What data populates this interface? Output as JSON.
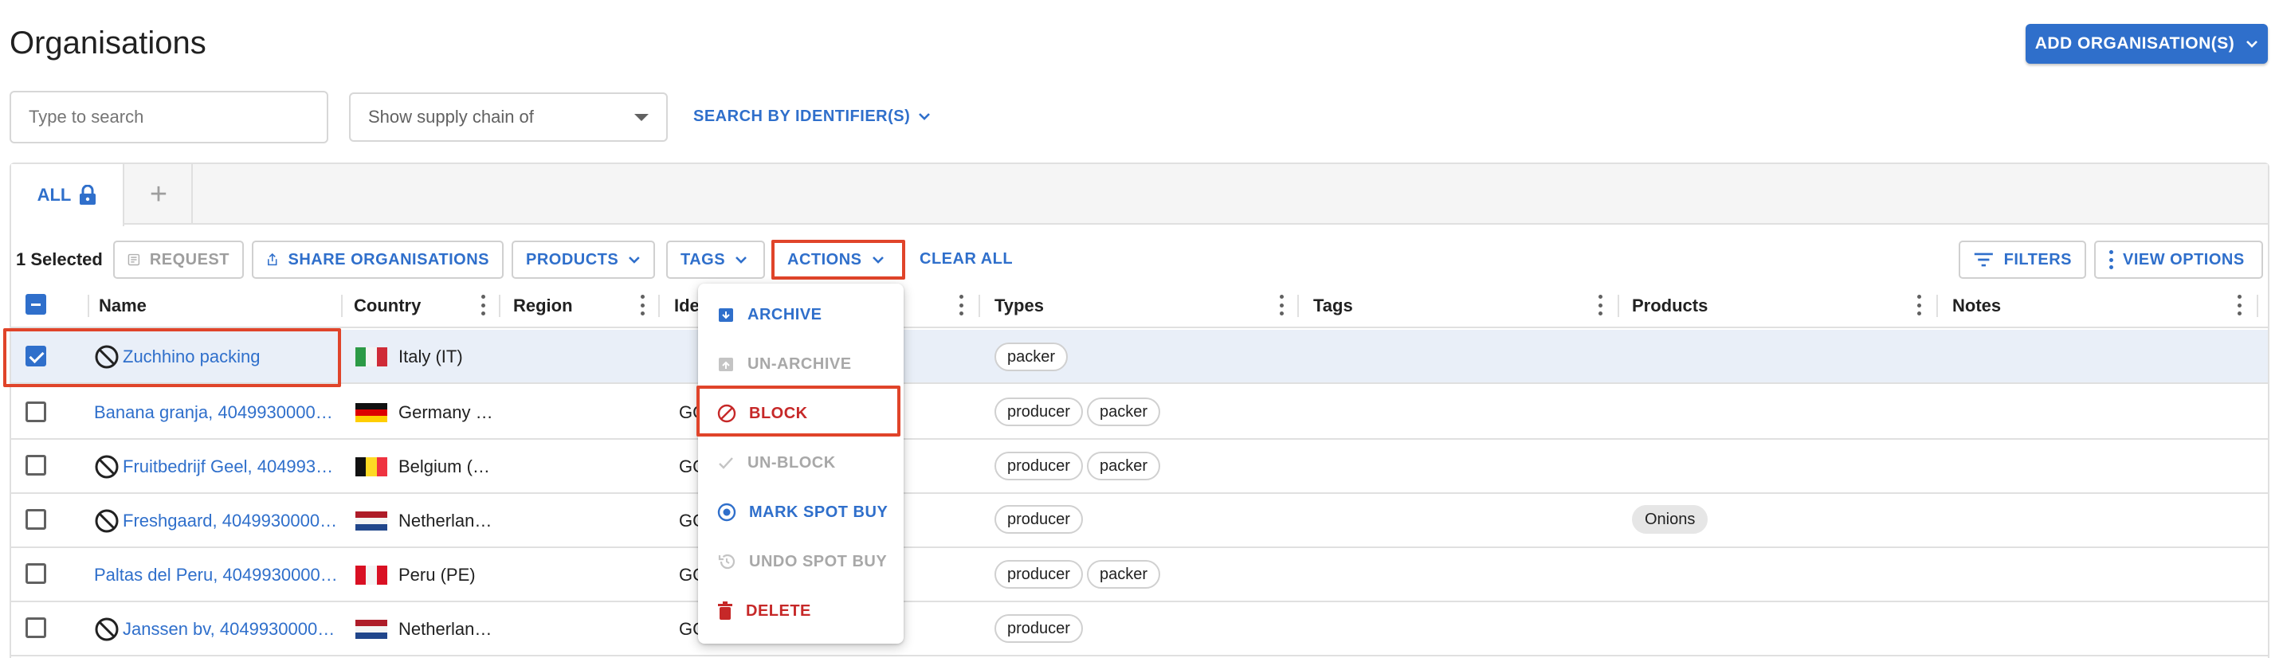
{
  "header": {
    "title": "Organisations",
    "add_button": "ADD ORGANISATION(S)"
  },
  "search": {
    "placeholder": "Type to search",
    "supply_chain_placeholder": "Show supply chain of",
    "identifier_button": "SEARCH BY IDENTIFIER(S)"
  },
  "tabs": {
    "all_label": "ALL",
    "add_label": "+"
  },
  "toolbar": {
    "selected_count": "1 Selected",
    "request": "REQUEST",
    "share": "SHARE ORGANISATIONS",
    "products": "PRODUCTS",
    "tags": "TAGS",
    "actions": "ACTIONS",
    "clear_all": "CLEAR ALL",
    "filters": "FILTERS",
    "view_options": "VIEW OPTIONS"
  },
  "columns": {
    "name": "Name",
    "country": "Country",
    "region": "Region",
    "identifier": "Ide",
    "types": "Types",
    "tags": "Tags",
    "products": "Products",
    "notes": "Notes"
  },
  "rows": [
    {
      "name": "Zuchhino packing",
      "country": "Italy (IT)",
      "identifier": "",
      "types": [
        "packer"
      ],
      "products": []
    },
    {
      "name": "Banana granja, 4049930000…",
      "country": "Germany …",
      "identifier": "GC",
      "types": [
        "producer",
        "packer"
      ],
      "products": []
    },
    {
      "name": "Fruitbedrijf Geel, 404993…",
      "country": "Belgium (…",
      "identifier": "GC",
      "types": [
        "producer",
        "packer"
      ],
      "products": []
    },
    {
      "name": "Freshgaard, 4049930000…",
      "country": "Netherlan…",
      "identifier": "GC",
      "types": [
        "producer"
      ],
      "products": [
        "Onions"
      ]
    },
    {
      "name": "Paltas del Peru, 4049930000…",
      "country": "Peru (PE)",
      "identifier": "GC",
      "types": [
        "producer",
        "packer"
      ],
      "products": []
    },
    {
      "name": "Janssen bv, 4049930000…",
      "country": "Netherlan…",
      "identifier": "GC",
      "types": [
        "producer"
      ],
      "products": []
    }
  ],
  "actions_menu": {
    "archive": "ARCHIVE",
    "unarchive": "UN-ARCHIVE",
    "block": "BLOCK",
    "unblock": "UN-BLOCK",
    "mark_spot_buy": "MARK SPOT BUY",
    "undo_spot_buy": "UNDO SPOT BUY",
    "delete": "DELETE"
  },
  "colors": {
    "accent": "#2f6fcb",
    "danger": "#c62828",
    "highlight": "#e0442a",
    "selected_row": "#e9eff8"
  },
  "icons": [
    "lock-icon",
    "chevron-down-icon",
    "share-icon",
    "request-icon",
    "filter-icon",
    "kebab-icon",
    "blocked-icon",
    "archive-icon",
    "block-icon",
    "check-icon",
    "spot-buy-icon",
    "undo-icon",
    "delete-icon"
  ]
}
